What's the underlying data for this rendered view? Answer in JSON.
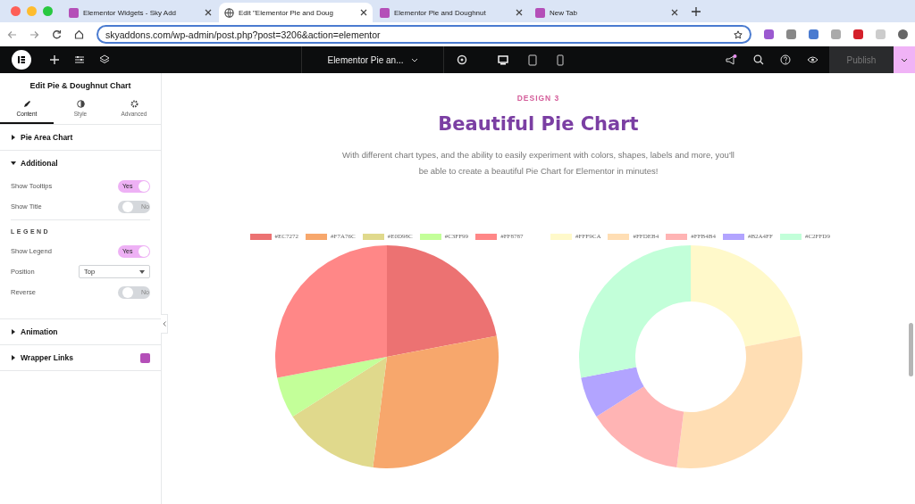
{
  "browser": {
    "tabs": [
      {
        "title": "Elementor Widgets - Sky Add",
        "selected": false
      },
      {
        "title": "Edit \"Elementor Pie and Doug",
        "selected": true
      },
      {
        "title": "Elementor Pie and Doughnut",
        "selected": false
      },
      {
        "title": "New Tab",
        "selected": false
      }
    ],
    "url": "skyaddons.com/wp-admin/post.php?post=3206&action=elementor"
  },
  "editor_bar": {
    "page_title": "Elementor Pie an...",
    "publish": "Publish"
  },
  "panel": {
    "title": "Edit Pie & Doughnut Chart",
    "tabs": [
      {
        "label": "Content",
        "selected": true
      },
      {
        "label": "Style",
        "selected": false
      },
      {
        "label": "Advanced",
        "selected": false
      }
    ],
    "sections": [
      {
        "title": "Pie Area Chart",
        "expanded": false
      },
      {
        "title": "Additional",
        "expanded": true,
        "controls": [
          {
            "kind": "switch",
            "label": "Show Tooltips",
            "on": true,
            "text": "Yes"
          },
          {
            "kind": "switch",
            "label": "Show Title",
            "on": false,
            "text": "No"
          },
          {
            "kind": "heading",
            "label": "LEGEND"
          },
          {
            "kind": "switch",
            "label": "Show Legend",
            "on": true,
            "text": "Yes"
          },
          {
            "kind": "select",
            "label": "Position",
            "value": "Top"
          },
          {
            "kind": "switch",
            "label": "Reverse",
            "on": false,
            "text": "No"
          }
        ]
      },
      {
        "title": "Animation",
        "expanded": false
      },
      {
        "title": "Wrapper Links",
        "expanded": false
      }
    ]
  },
  "preview": {
    "eyebrow": "DESIGN 3",
    "heading": "Beautiful Pie Chart",
    "description": "With different chart types, and the ability to easily experiment with colors, shapes, labels and more, you'll be able to create a beautiful Pie Chart for Elementor in minutes!",
    "charts": [
      {
        "kind": "pie",
        "legend": [
          {
            "label": "#EC7272",
            "color": "#ec7272"
          },
          {
            "label": "#F7A76C",
            "color": "#f7a76c"
          },
          {
            "label": "#E0D98C",
            "color": "#e0d98c"
          },
          {
            "label": "#C3FF99",
            "color": "#c3ff99"
          },
          {
            "label": "#FF8787",
            "color": "#ff8787"
          }
        ]
      },
      {
        "kind": "donut",
        "legend": [
          {
            "label": "#FFF9CA",
            "color": "#fff9ca"
          },
          {
            "label": "#FFDEB4",
            "color": "#ffdeb4"
          },
          {
            "label": "#FFB4B4",
            "color": "#ffb4b4"
          },
          {
            "label": "#B2A4FF",
            "color": "#b2a4ff"
          },
          {
            "label": "#C2FFD9",
            "color": "#c2ffd9"
          }
        ]
      }
    ]
  }
}
